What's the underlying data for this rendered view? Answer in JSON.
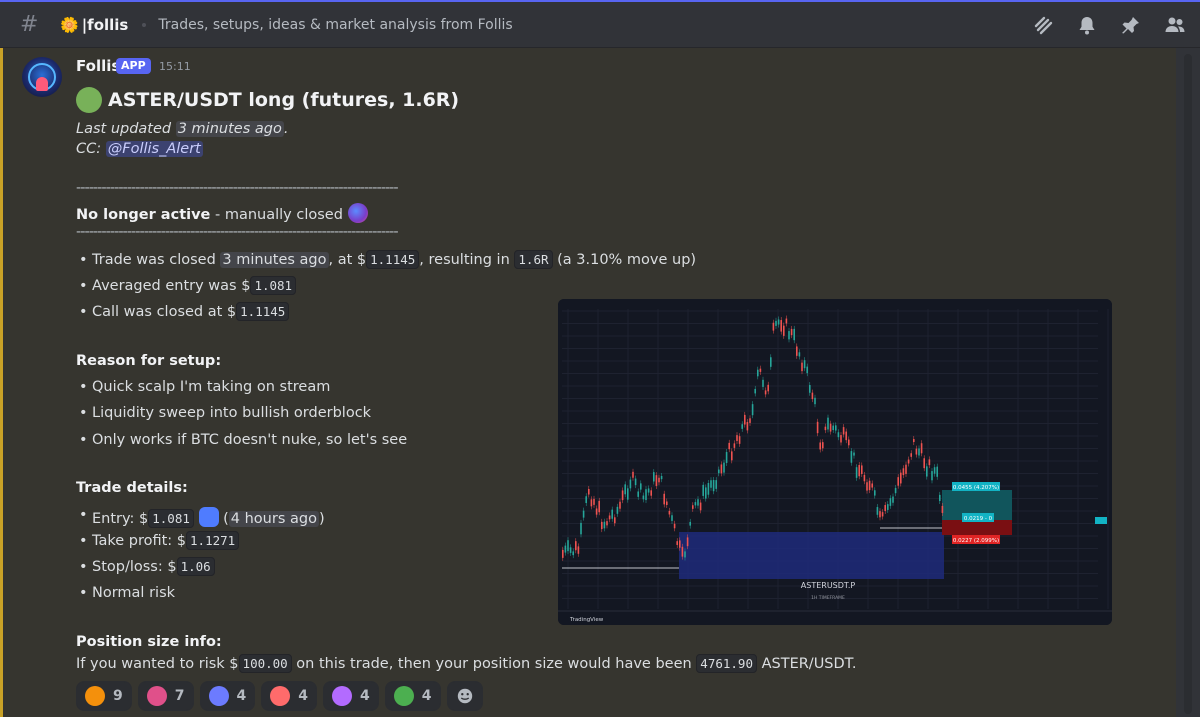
{
  "header": {
    "channel_emoji": "🌼",
    "channel_name": "|follis",
    "topic": "Trades, setups, ideas & market analysis from Follis",
    "icons": [
      "threads-icon",
      "bell-icon",
      "pin-icon",
      "members-icon"
    ]
  },
  "message": {
    "author": "Follis",
    "badge": "APP",
    "timestamp": "15:11",
    "title": "ASTER/USDT long (futures, 1.6R)",
    "last_updated_prefix": "Last updated ",
    "last_updated_value": "3 minutes ago",
    "last_updated_suffix": ".",
    "cc_prefix": "CC: ",
    "cc_mention": "@Follis_Alert",
    "divider": "----------------------------------------------------------------------------",
    "status_bold": "No longer active",
    "status_rest": " - manually closed",
    "close_bullets": {
      "b1_a": "Trade was closed ",
      "b1_time": "3 minutes ago",
      "b1_b": ", at $",
      "b1_price": "1.1145",
      "b1_c": ", resulting in ",
      "b1_r": "1.6R",
      "b1_d": " (a 3.10% move up)",
      "b2_a": "Averaged entry was $",
      "b2_price": "1.081",
      "b3_a": "Call was closed at $",
      "b3_price": "1.1145"
    },
    "reason_heading": "Reason for setup:",
    "reasons": [
      "Quick scalp I'm taking on stream",
      "Liquidity sweep into bullish orderblock",
      "Only works if BTC doesn't nuke, so let's see"
    ],
    "details_heading": "Trade details:",
    "details": {
      "entry_label": "Entry: $",
      "entry_value": "1.081",
      "entry_time_open": " (",
      "entry_time": "4 hours ago",
      "entry_time_close": ")",
      "tp_label": "Take profit: $",
      "tp_value": "1.1271",
      "sl_label": "Stop/loss: $",
      "sl_value": "1.06",
      "risk": "Normal risk"
    },
    "position_heading": "Position size info:",
    "position": {
      "a": "If you wanted to risk $",
      "risk": "100.00",
      "b": " on this trade, then your position size would have been ",
      "size": "4761.90",
      "c": " ASTER/USDT."
    }
  },
  "chart_embed": {
    "symbol": "ASTERUSDT.P",
    "timeframe": "1H TIMEFRAME",
    "brand": "TradingView",
    "tp_label": "0.0455 (4.207%)",
    "mid_label": "0.0219 - 0",
    "sl_label": "0.0227 (2.099%)"
  },
  "reactions": [
    {
      "icon": "fire-emoji",
      "count": "9",
      "color": "#f4900c"
    },
    {
      "icon": "custom-emoji-1",
      "count": "7",
      "color": "#e0508a"
    },
    {
      "icon": "heart-emoji",
      "count": "4",
      "color": "#6c7bff"
    },
    {
      "icon": "custom-emoji-2",
      "count": "4",
      "color": "#ff6b6b"
    },
    {
      "icon": "custom-emoji-3",
      "count": "4",
      "color": "#b36bff"
    },
    {
      "icon": "custom-emoji-4",
      "count": "4",
      "color": "#4caf50"
    }
  ]
}
